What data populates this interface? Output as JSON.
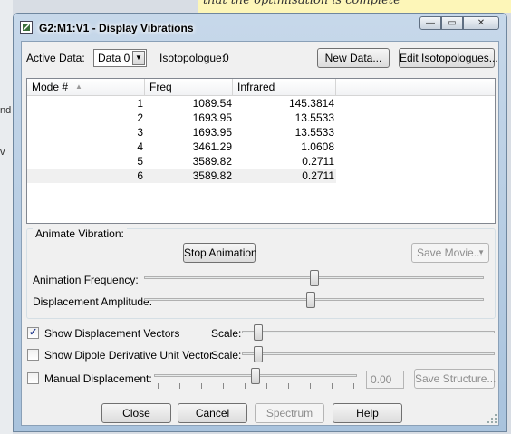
{
  "background": {
    "note_text": "that the optimisation is complete",
    "left_fragment_1": "nd",
    "left_fragment_2": "v"
  },
  "window": {
    "title": "G2:M1:V1 - Display Vibrations",
    "min_glyph": "—",
    "max_glyph": "▭",
    "close_glyph": "✕"
  },
  "top": {
    "active_data_label": "Active Data:",
    "active_data_value": "Data 0",
    "isotopologue_label": "Isotopologue:",
    "isotopologue_value": "0",
    "new_data_button": "New Data...",
    "edit_isotopologues_button": "Edit Isotopologues..."
  },
  "table": {
    "columns": [
      "Mode #",
      "Freq",
      "Infrared"
    ],
    "rows": [
      {
        "mode": "1",
        "freq": "1089.54",
        "infrared": "145.3814"
      },
      {
        "mode": "2",
        "freq": "1693.95",
        "infrared": "13.5533"
      },
      {
        "mode": "3",
        "freq": "1693.95",
        "infrared": "13.5533"
      },
      {
        "mode": "4",
        "freq": "3461.29",
        "infrared": "1.0608"
      },
      {
        "mode": "5",
        "freq": "3589.82",
        "infrared": "0.2711"
      },
      {
        "mode": "6",
        "freq": "3589.82",
        "infrared": "0.2711"
      }
    ],
    "selected_row": 6
  },
  "animate": {
    "group_label": "Animate Vibration:",
    "stop_button": "Stop Animation",
    "save_movie_button": "Save Movie...",
    "frequency_label": "Animation Frequency:",
    "amplitude_label": "Displacement Amplitude:",
    "frequency_level": 0.5,
    "amplitude_level": 0.49
  },
  "options": {
    "show_vectors_label": "Show Displacement Vectors",
    "show_vectors_checked": true,
    "show_dipole_label": "Show Dipole Derivative Unit Vector",
    "show_dipole_checked": false,
    "manual_label": "Manual Displacement:",
    "manual_checked": false,
    "scale_label": "Scale:",
    "vectors_scale_level": 0.05,
    "dipole_scale_level": 0.05,
    "manual_level": 0.5,
    "manual_value": "0.00",
    "save_structure_button": "Save Structure..."
  },
  "footer": {
    "close_button": "Close",
    "cancel_button": "Cancel",
    "spectrum_button": "Spectrum",
    "help_button": "Help"
  }
}
